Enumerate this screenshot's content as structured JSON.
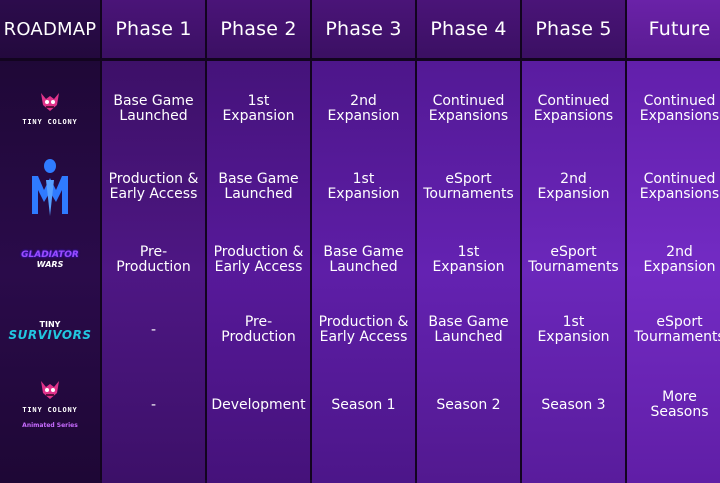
{
  "header": {
    "corner_label": "ROADMAP",
    "phases": [
      "Phase 1",
      "Phase 2",
      "Phase 3",
      "Phase 4",
      "Phase 5",
      "Future"
    ]
  },
  "games": [
    {
      "logo_text": "TINY COLONY",
      "logo_icon": "tiny-colony-logo",
      "cells": [
        "Base Game\nLaunched",
        "1st\nExpansion",
        "2nd\nExpansion",
        "Continued\nExpansions",
        "Continued\nExpansions",
        "Continued\nExpansions"
      ]
    },
    {
      "logo_text": "",
      "logo_icon": "mm-logo",
      "cells": [
        "Production &\nEarly Access",
        "Base Game\nLaunched",
        "1st\nExpansion",
        "eSport\nTournaments",
        "2nd\nExpansion",
        "Continued\nExpansions"
      ]
    },
    {
      "logo_text": "GLADIATOR",
      "logo_text2": "WARS",
      "logo_icon": "gladiator-wars-logo",
      "cells": [
        "Pre-\nProduction",
        "Production &\nEarly Access",
        "Base Game\nLaunched",
        "1st\nExpansion",
        "eSport\nTournaments",
        "2nd\nExpansion"
      ]
    },
    {
      "logo_text": "TINY",
      "logo_text2": "SURVIVORS",
      "logo_icon": "tiny-survivors-logo",
      "cells": [
        "-",
        "Pre-\nProduction",
        "Production &\nEarly Access",
        "Base Game\nLaunched",
        "1st\nExpansion",
        "eSport\nTournaments"
      ]
    },
    {
      "logo_text": "TINY COLONY",
      "logo_text2": "Animated Series",
      "logo_icon": "tiny-colony-animated-logo",
      "cells": [
        "-",
        "Development",
        "Season 1",
        "Season 2",
        "Season 3",
        "More\nSeasons"
      ]
    }
  ],
  "colors": {
    "background": "#12041f",
    "accent_purple": "#6422b2",
    "logo_magenta": "#e0338a",
    "logo_blue": "#2f7bff",
    "logo_cyan": "#22c7e0"
  }
}
